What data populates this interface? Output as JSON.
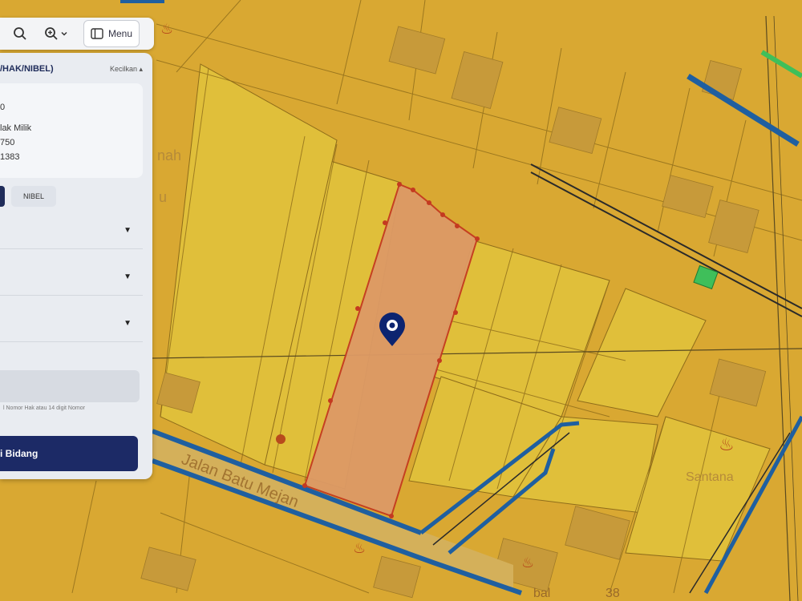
{
  "toolbar": {
    "menu_label": "Menu"
  },
  "panel": {
    "title": "/HAK/NIBEL)",
    "collapse_label": "Kecilkan",
    "info_lines": [
      "0",
      "lak Milik",
      "750",
      "1383"
    ],
    "chip_label": "NIBEL",
    "input_hint": "l Nomor Hak atau 14 digit Nomor",
    "submit_label": "i Bidang"
  },
  "map": {
    "labels": {
      "road": "Jalan Batu Mejan",
      "place_top_left": "nah",
      "place_top_left_2": "u",
      "place_right": "Santana",
      "place_bottom": "38",
      "place_bottom_2": "bal"
    }
  },
  "colors": {
    "map_background": "#d9a832",
    "parcel_fill": "#dd9a66",
    "parcel_border": "#c43a20",
    "road_outline": "#1f5fa0",
    "green_tag": "#3fbf5a",
    "marker": "#0c2470",
    "panel_primary": "#1c2a66"
  },
  "icons": [
    "search-icon",
    "zoom-icon",
    "chevron-down-icon",
    "menu-icon",
    "location-pin-icon"
  ]
}
